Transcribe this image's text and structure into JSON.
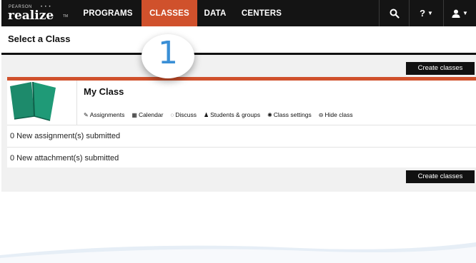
{
  "brand": {
    "pearson": "PEARSON",
    "name": "realize",
    "tm": "TM"
  },
  "nav": {
    "items": [
      {
        "label": "PROGRAMS",
        "active": false
      },
      {
        "label": "CLASSES",
        "active": true
      },
      {
        "label": "DATA",
        "active": false
      },
      {
        "label": "CENTERS",
        "active": false
      }
    ],
    "help_label": "?",
    "icons": {
      "search": "search-icon",
      "help": "help-icon",
      "user": "user-icon"
    }
  },
  "page": {
    "title": "Select a Class"
  },
  "buttons": {
    "create_top": "Create classes",
    "create_bottom": "Create classes"
  },
  "class_card": {
    "name": "My Class",
    "actions": [
      {
        "icon": "assignments-icon",
        "label": "Assignments"
      },
      {
        "icon": "calendar-icon",
        "label": "Calendar"
      },
      {
        "icon": "discuss-icon",
        "label": "Discuss"
      },
      {
        "icon": "students-icon",
        "label": "Students & groups"
      },
      {
        "icon": "gear-icon",
        "label": "Class settings"
      },
      {
        "icon": "hide-icon",
        "label": "Hide class"
      }
    ],
    "rows": [
      "0 New assignment(s) submitted",
      "0 New attachment(s) submitted"
    ]
  },
  "annotation": {
    "number": "1"
  },
  "colors": {
    "accent": "#d0512c",
    "nav_bg": "#141414",
    "annotation": "#3a8fd6",
    "book": "#1d8a6b"
  }
}
